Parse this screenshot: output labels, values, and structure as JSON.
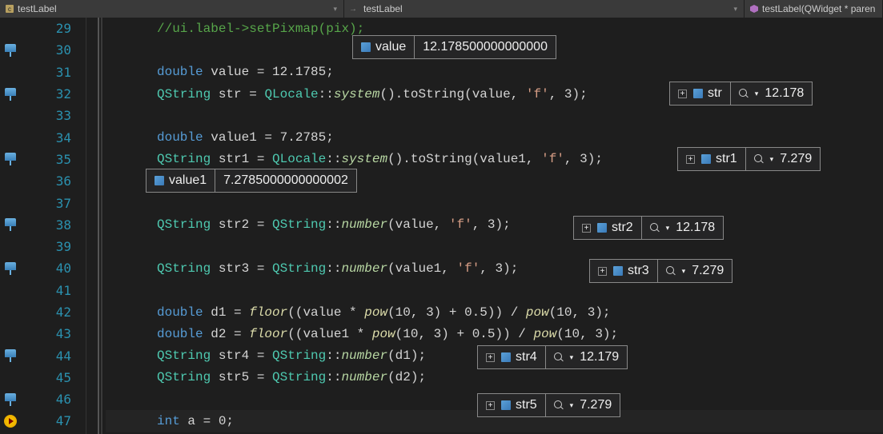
{
  "tabs": [
    {
      "label": "testLabel"
    },
    {
      "label": "testLabel"
    },
    {
      "label": "testLabel(QWidget * paren"
    }
  ],
  "line_numbers": [
    "29",
    "30",
    "31",
    "32",
    "33",
    "34",
    "35",
    "36",
    "37",
    "38",
    "39",
    "40",
    "41",
    "42",
    "43",
    "44",
    "45",
    "46",
    "47"
  ],
  "code": {
    "l29": "//ui.label->setPixmap(pix);",
    "l31_kw": "double",
    "l31_rest": " value = 12.1785;",
    "l32_type": "QString",
    "l32_a": " str = ",
    "l32_qloc": "QLocale",
    "l32_b": "::",
    "l32_sys": "system",
    "l32_c": "().",
    "l32_tostr": "toString",
    "l32_d": "(value, ",
    "l32_s": "'f'",
    "l32_e": ", 3);",
    "l34_kw": "double",
    "l34_rest": " value1 = 7.2785;",
    "l35_type": "QString",
    "l35_a": " str1 = ",
    "l35_qloc": "QLocale",
    "l35_b": "::",
    "l35_sys": "system",
    "l35_c": "().",
    "l35_tostr": "toString",
    "l35_d": "(value1, ",
    "l35_s": "'f'",
    "l35_e": ", 3);",
    "l38_type": "QString",
    "l38_a": " str2 = ",
    "l38_q": "QString",
    "l38_b": "::",
    "l38_num": "number",
    "l38_c": "(value, ",
    "l38_s": "'f'",
    "l38_d": ", 3);",
    "l40_type": "QString",
    "l40_a": " str3 = ",
    "l40_q": "QString",
    "l40_b": "::",
    "l40_num": "number",
    "l40_c": "(value1, ",
    "l40_s": "'f'",
    "l40_d": ", 3);",
    "l42_kw": "double",
    "l42_a": " d1 = ",
    "l42_floor": "floor",
    "l42_b": "((value * ",
    "l42_pow1": "pow",
    "l42_c": "(10, 3) + 0.5)) / ",
    "l42_pow2": "pow",
    "l42_d": "(10, 3);",
    "l43_kw": "double",
    "l43_a": " d2 = ",
    "l43_floor": "floor",
    "l43_b": "((value1 * ",
    "l43_pow1": "pow",
    "l43_c": "(10, 3) + 0.5)) / ",
    "l43_pow2": "pow",
    "l43_d": "(10, 3);",
    "l44_type": "QString",
    "l44_a": " str4 = ",
    "l44_q": "QString",
    "l44_b": "::",
    "l44_num": "number",
    "l44_c": "(d1);",
    "l45_type": "QString",
    "l45_a": " str5 = ",
    "l45_q": "QString",
    "l45_b": "::",
    "l45_num": "number",
    "l45_c": "(d2);",
    "l47_kw": "int",
    "l47_rest": " a = 0;"
  },
  "datatips": {
    "value_name": "value",
    "value_val": "12.178500000000000",
    "str_name": "str",
    "str_val": "12.178",
    "value1_name": "value1",
    "value1_val": "7.2785000000000002",
    "str1_name": "str1",
    "str1_val": "7.279",
    "str2_name": "str2",
    "str2_val": "12.178",
    "str3_name": "str3",
    "str3_val": "7.279",
    "str4_name": "str4",
    "str4_val": "12.179",
    "str5_name": "str5",
    "str5_val": "7.279"
  }
}
